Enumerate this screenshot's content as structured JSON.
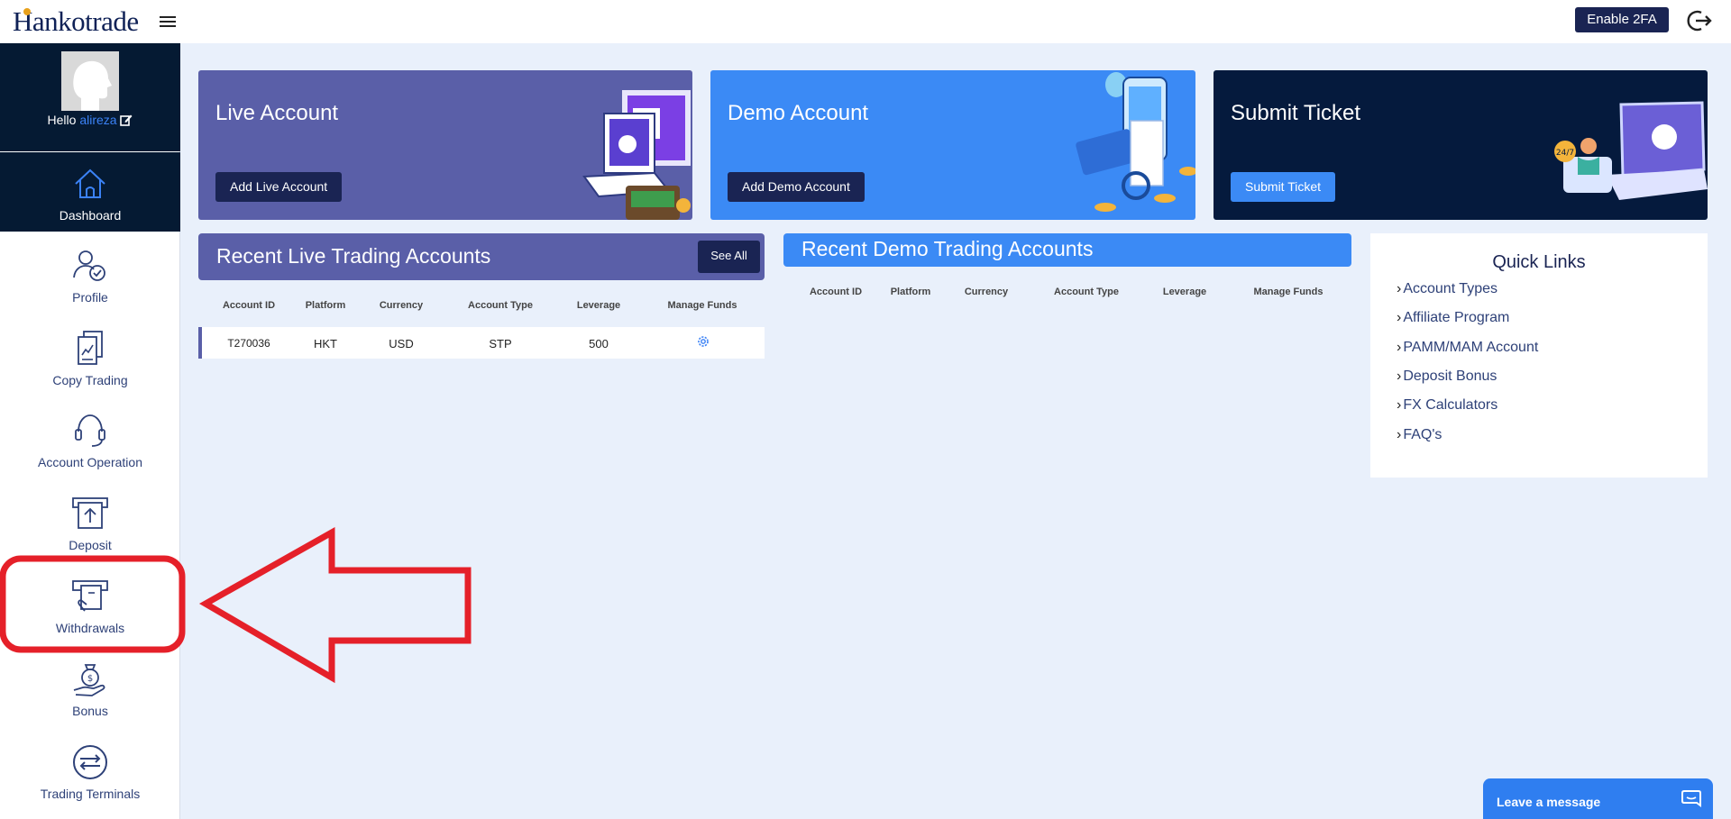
{
  "header": {
    "logo_text": "Hankotrade",
    "enable_2fa": "Enable 2FA"
  },
  "sidebar": {
    "greeting": "Hello",
    "username": "alireza",
    "items": [
      {
        "label": "Dashboard",
        "icon": "home-icon"
      },
      {
        "label": "Profile",
        "icon": "profile-icon"
      },
      {
        "label": "Copy Trading",
        "icon": "copy-trading-icon"
      },
      {
        "label": "Account Operation",
        "icon": "headset-icon"
      },
      {
        "label": "Deposit",
        "icon": "deposit-icon"
      },
      {
        "label": "Withdrawals",
        "icon": "withdrawal-icon"
      },
      {
        "label": "Bonus",
        "icon": "bonus-icon"
      },
      {
        "label": "Trading Terminals",
        "icon": "terminal-icon"
      }
    ]
  },
  "cards": {
    "live": {
      "title": "Live Account",
      "button": "Add Live Account",
      "color": "#5a5fa8"
    },
    "demo": {
      "title": "Demo Account",
      "button": "Add Demo Account",
      "color": "#3b8af5"
    },
    "ticket": {
      "title": "Submit Ticket",
      "button": "Submit Ticket",
      "color": "#051a3d"
    }
  },
  "live_accounts": {
    "title": "Recent Live Trading Accounts",
    "see_all": "See All",
    "columns": [
      "Account ID",
      "Platform",
      "Currency",
      "Account Type",
      "Leverage",
      "Manage Funds"
    ],
    "rows": [
      {
        "account_id": "T270036",
        "platform": "HKT",
        "currency": "USD",
        "account_type": "STP",
        "leverage": "500"
      }
    ]
  },
  "demo_accounts": {
    "title": "Recent Demo Trading Accounts",
    "columns": [
      "Account ID",
      "Platform",
      "Currency",
      "Account Type",
      "Leverage",
      "Manage Funds"
    ]
  },
  "quick_links": {
    "title": "Quick Links",
    "items": [
      "Account Types",
      "Affiliate Program",
      "PAMM/MAM Account",
      "Deposit Bonus",
      "FX Calculators",
      "FAQ's"
    ]
  },
  "chat": {
    "label": "Leave a message"
  },
  "annotation": {
    "highlight_color": "#e52029"
  }
}
